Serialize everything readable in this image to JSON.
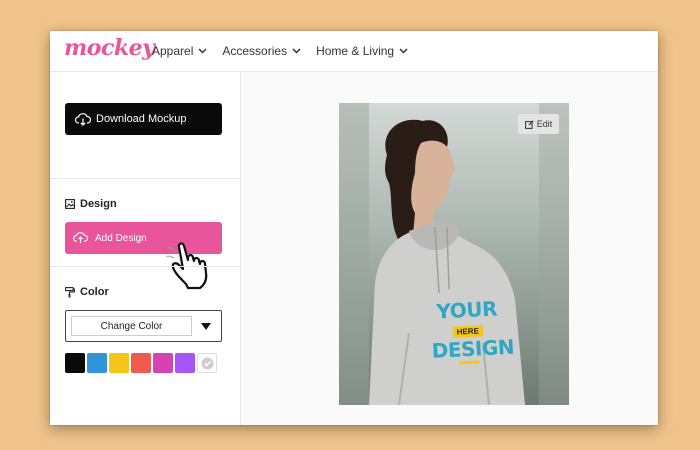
{
  "brand": {
    "logo_text": "mockey",
    "color": "#e8559a"
  },
  "nav": {
    "items": [
      {
        "label": "Apparel"
      },
      {
        "label": "Accessories"
      },
      {
        "label": "Home & Living"
      }
    ]
  },
  "sidebar": {
    "download_label": "Download Mockup",
    "design_section": "Design",
    "add_design_label": "Add Design",
    "color_section": "Color",
    "change_color_label": "Change Color",
    "swatches": [
      "#0a0a0a",
      "#2f95d8",
      "#f5c518",
      "#f05a4f",
      "#d542b4",
      "#a855f7"
    ]
  },
  "preview": {
    "edit_label": "Edit",
    "print_line1": "YOUR",
    "print_middle": "HERE",
    "print_line2": "DESIGN"
  }
}
